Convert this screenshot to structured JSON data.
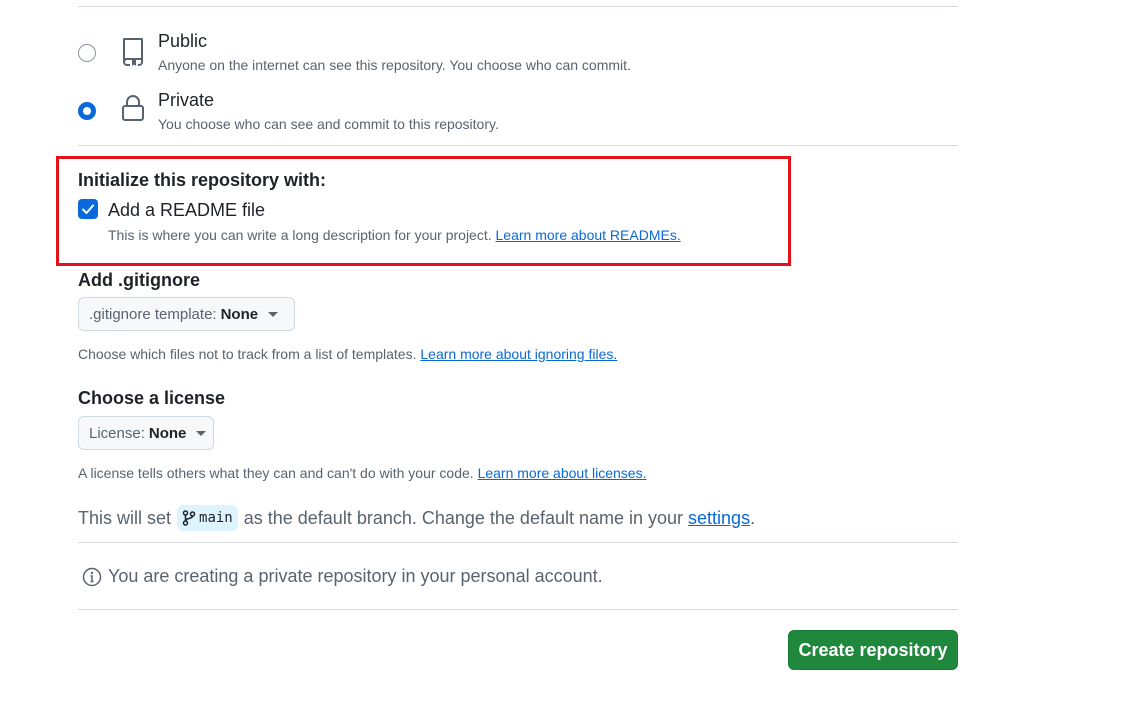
{
  "visibility": {
    "options": [
      {
        "title": "Public",
        "description": "Anyone on the internet can see this repository. You choose who can commit.",
        "selected": false,
        "icon": "repo-icon"
      },
      {
        "title": "Private",
        "description": "You choose who can see and commit to this repository.",
        "selected": true,
        "icon": "lock-icon"
      }
    ]
  },
  "initialize": {
    "title": "Initialize this repository with:",
    "readme_label": "Add a README file",
    "readme_checked": true,
    "readme_desc": "This is where you can write a long description for your project.",
    "readme_link": "Learn more about READMEs."
  },
  "gitignore": {
    "title": "Add .gitignore",
    "select_prefix": ".gitignore template:",
    "select_value": "None",
    "help": "Choose which files not to track from a list of templates.",
    "help_link": "Learn more about ignoring files."
  },
  "license": {
    "title": "Choose a license",
    "select_prefix": "License:",
    "select_value": "None",
    "help": "A license tells others what they can and can't do with your code.",
    "help_link": "Learn more about licenses."
  },
  "branch": {
    "prefix": "This will set",
    "branch_name": "main",
    "middle": "as the default branch. Change the default name in your",
    "settings_link": "settings",
    "suffix": "."
  },
  "notice": {
    "text": "You are creating a private repository in your personal account."
  },
  "actions": {
    "create_label": "Create repository"
  },
  "colors": {
    "accent": "#0969da",
    "primary_button": "#1f883d",
    "highlight_border": "#e3121b"
  }
}
